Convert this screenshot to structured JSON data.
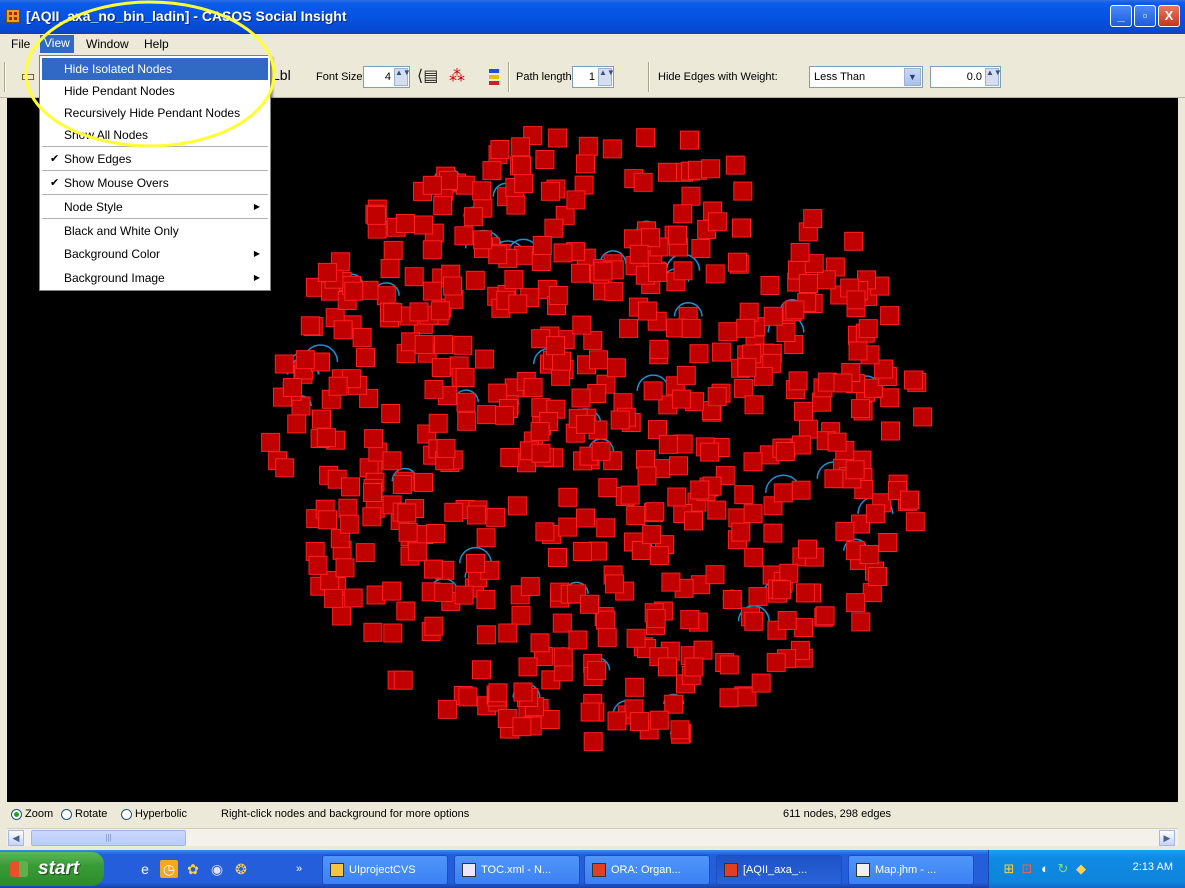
{
  "window": {
    "title": "[AQII_axa_no_bin_ladin] - CASOS Social Insight",
    "minimize": "_",
    "maximize": "▫",
    "close": "X"
  },
  "menubar": {
    "file": "File",
    "view": "View",
    "window": "Window",
    "help": "Help"
  },
  "view_menu": {
    "items": [
      {
        "label": "Hide Isolated Nodes",
        "highlighted": true
      },
      {
        "label": "Hide Pendant Nodes"
      },
      {
        "label": "Recursively Hide Pendant Nodes"
      },
      {
        "label": "Show All Nodes"
      },
      {
        "label": "Show Edges",
        "checked": true
      },
      {
        "label": "Show Mouse Overs",
        "checked": true
      },
      {
        "label": "Node Style",
        "submenu": true
      },
      {
        "label": "Black and White Only"
      },
      {
        "label": "Background Color",
        "submenu": true
      },
      {
        "label": "Background Image",
        "submenu": true
      }
    ],
    "check": "✔",
    "arrow": "▶"
  },
  "toolbar": {
    "lbl": "Lbl",
    "font_size_label": "Font Size",
    "font_size_value": "4",
    "path_length_label": "Path length",
    "path_length_value": "1",
    "hide_edges_label": "Hide Edges with Weight:",
    "weight_operator": "Less Than",
    "weight_value": "0.0",
    "spin_arrows": "▲▼",
    "dropdown_arrow": "▼"
  },
  "status": {
    "zoom": "Zoom",
    "rotate": "Rotate",
    "hyperbolic": "Hyperbolic",
    "mode_selected": "Zoom",
    "hint": "Right-click nodes and background for more options",
    "counts": "611 nodes, 298 edges"
  },
  "scrollbar": {
    "left_arrow": "◀",
    "right_arrow": "▶",
    "thumb_grip": "|||"
  },
  "graph": {
    "node_count": 611,
    "edge_count": 298,
    "background": "#000000",
    "node_fill": "#C00000",
    "node_stroke": "#FF2020",
    "edge_color": "#1E90D0"
  },
  "taskbar": {
    "start": "start",
    "chevron": "»",
    "tasks": [
      {
        "label": "UIprojectCVS",
        "icon": "folder-icon"
      },
      {
        "label": "TOC.xml - N...",
        "icon": "document-icon"
      },
      {
        "label": "ORA: Organ...",
        "icon": "ora-app-icon"
      },
      {
        "label": "[AQII_axa_...",
        "icon": "casos-app-icon",
        "active": true
      },
      {
        "label": "Map.jhm - ...",
        "icon": "notepad-icon"
      }
    ],
    "clock": "2:13 AM"
  },
  "colors": {
    "title_bar": "#0553E1",
    "menu_highlight": "#316AC5",
    "annotation_ellipse": "#FFFF33",
    "taskbar": "#245EDB",
    "start_button": "#389C36"
  }
}
